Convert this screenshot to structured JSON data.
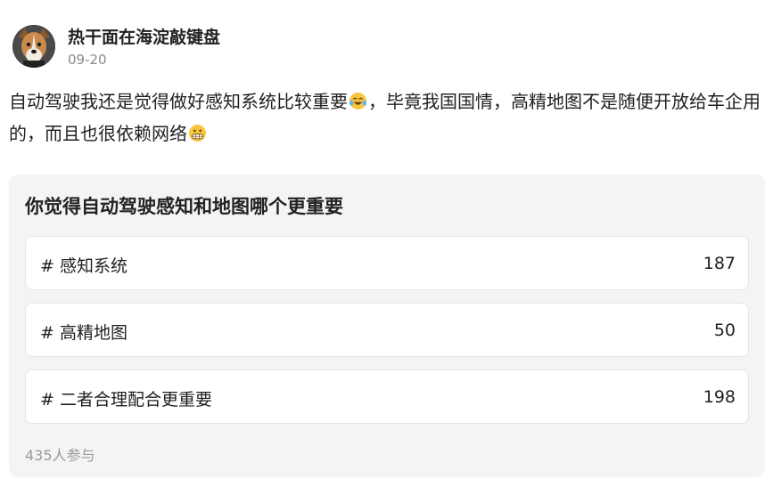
{
  "post": {
    "author": "热干面在海淀敲键盘",
    "date": "09-20",
    "text_part1": "自动驾驶我还是觉得做好感知系统比较重要",
    "text_part2": "，毕竟我国国情，高精地图不是随便开放给车企用的，而且也很依赖网络",
    "emoji1": "laughing-tears-emoji",
    "emoji2": "grimace-emoji"
  },
  "poll": {
    "title": "你觉得自动驾驶感知和地图哪个更重要",
    "options": [
      {
        "label": "# 感知系统",
        "count": "187"
      },
      {
        "label": "# 高精地图",
        "count": "50"
      },
      {
        "label": "# 二者合理配合更重要",
        "count": "198"
      }
    ],
    "participants": "435人参与"
  }
}
